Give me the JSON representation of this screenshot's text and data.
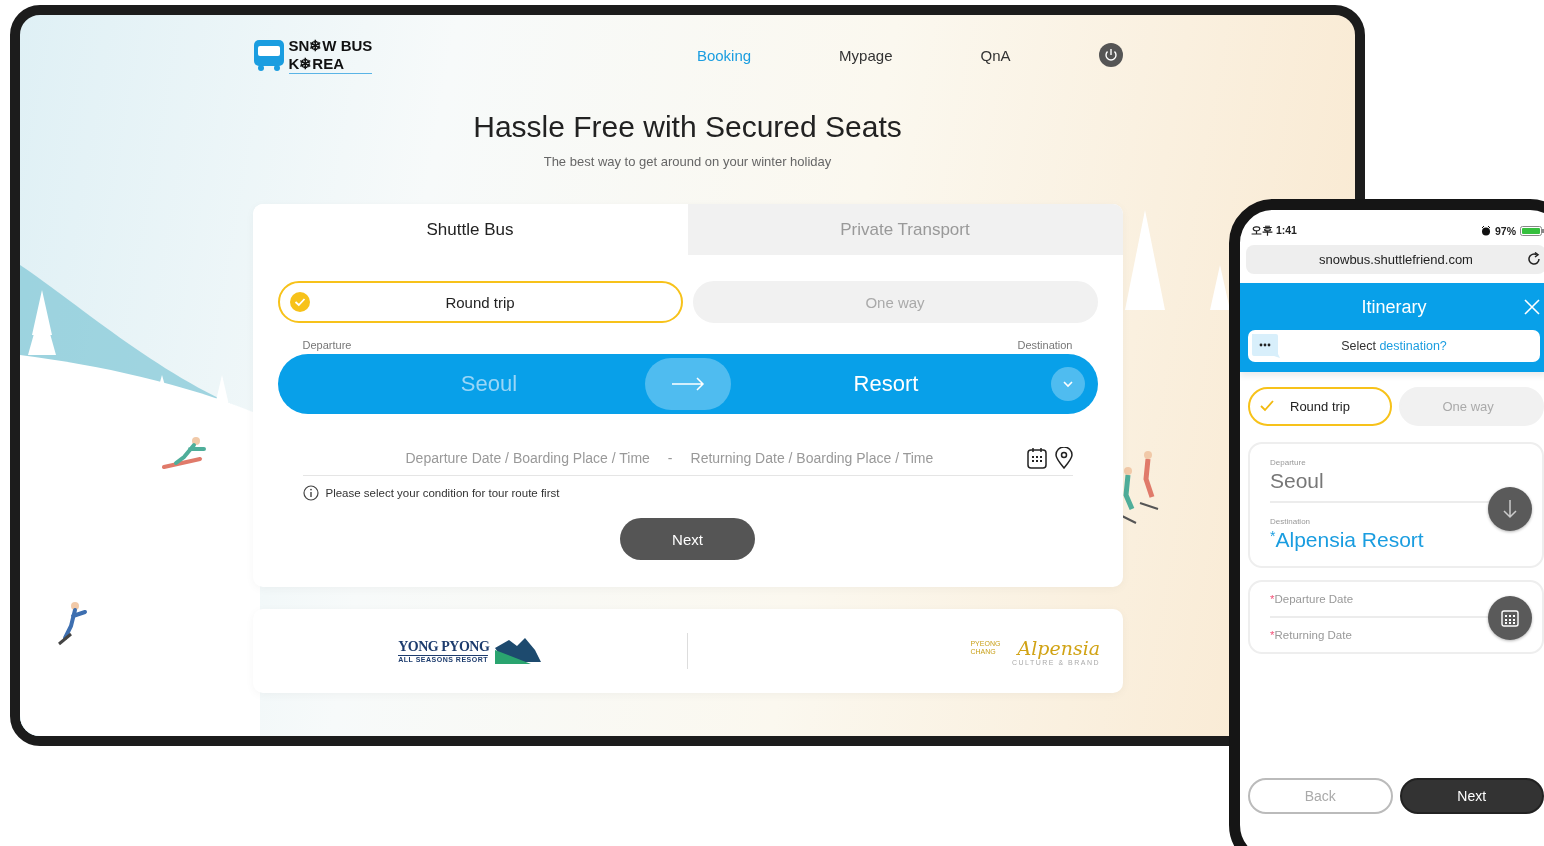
{
  "tablet": {
    "logo": {
      "line1": "SN❄W BUS",
      "line2": "K❄REA"
    },
    "nav": [
      {
        "label": "Booking",
        "selected": true
      },
      {
        "label": "Mypage",
        "selected": false
      },
      {
        "label": "QnA",
        "selected": false
      }
    ],
    "hero": {
      "title": "Hassle Free with Secured Seats",
      "subtitle": "The best way to get around on your winter holiday"
    },
    "tabs": [
      {
        "label": "Shuttle Bus",
        "selected": true
      },
      {
        "label": "Private Transport",
        "selected": false
      }
    ],
    "trip_types": [
      {
        "label": "Round trip",
        "selected": true
      },
      {
        "label": "One way",
        "selected": false
      }
    ],
    "route": {
      "departure_label": "Departure",
      "destination_label": "Destination",
      "departure": "Seoul",
      "destination": "Resort"
    },
    "schedule": {
      "departure_placeholder": "Departure Date / Boarding Place / Time",
      "separator": "-",
      "returning_placeholder": "Returning Date / Boarding Place / Time"
    },
    "notice": "Please select your condition for tour route first",
    "next_button": "Next",
    "partners": [
      {
        "kind": "yongpyong",
        "name": "YONG PYONG",
        "tagline": "ALL SEASONS RESORT"
      },
      {
        "kind": "alpensia",
        "prefix": "PYEONG CHANG",
        "name": "Alpensia",
        "tagline": "CULTURE & BRAND"
      }
    ]
  },
  "phone": {
    "status_bar": {
      "time": "오후 1:41",
      "battery": "97%"
    },
    "address_bar": "snowbus.shuttlefriend.com",
    "title": "Itinerary",
    "prompt": {
      "text": "Select",
      "highlight": "destination?"
    },
    "trip_types": [
      {
        "label": "Round trip",
        "selected": true
      },
      {
        "label": "One way",
        "selected": false
      }
    ],
    "route": {
      "departure_label": "Departure",
      "departure": "Seoul",
      "destination_label": "Destination",
      "destination_mark": "*",
      "destination": "Alpensia Resort"
    },
    "dates": [
      {
        "mark": "*",
        "label": "Departure Date"
      },
      {
        "mark": "*",
        "label": "Returning Date"
      }
    ],
    "buttons": [
      {
        "label": "Back",
        "kind": "outline"
      },
      {
        "label": "Next",
        "kind": "primary"
      }
    ]
  }
}
